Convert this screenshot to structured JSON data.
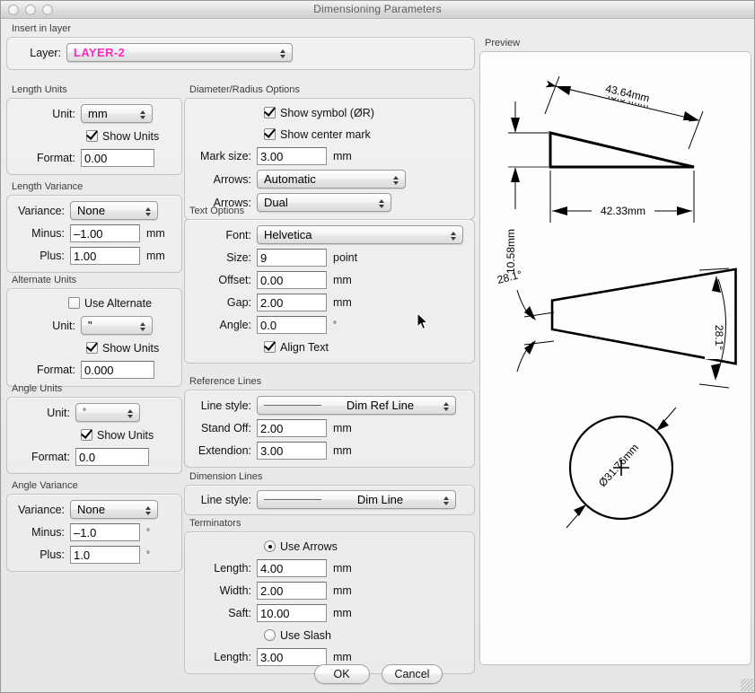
{
  "window": {
    "title": "Dimensioning Parameters",
    "traffic": [
      "close-button",
      "minimize-button",
      "zoom-button"
    ]
  },
  "insert_in_layer": {
    "group_label": "Insert in layer",
    "layer_label": "Layer:",
    "layer_value": "LAYER-2",
    "layer_color": "#ff26c8"
  },
  "length_units": {
    "group_label": "Length Units",
    "unit_label": "Unit:",
    "unit_value": "mm",
    "show_units_label": "Show Units",
    "show_units_checked": true,
    "format_label": "Format:",
    "format_value": "0.00"
  },
  "length_variance": {
    "group_label": "Length Variance",
    "variance_label": "Variance:",
    "variance_value": "None",
    "minus_label": "Minus:",
    "minus_value": "–1.00",
    "minus_unit": "mm",
    "plus_label": "Plus:",
    "plus_value": "1.00",
    "plus_unit": "mm"
  },
  "alternate_units": {
    "group_label": "Alternate Units",
    "use_alternate_label": "Use Alternate",
    "use_alternate_checked": false,
    "unit_label": "Unit:",
    "unit_value": "\"",
    "show_units_label": "Show Units",
    "show_units_checked": true,
    "format_label": "Format:",
    "format_value": "0.000"
  },
  "angle_units": {
    "group_label": "Angle Units",
    "unit_label": "Unit:",
    "unit_value": "°",
    "show_units_label": "Show Units",
    "show_units_checked": true,
    "format_label": "Format:",
    "format_value": "0.0"
  },
  "angle_variance": {
    "group_label": "Angle Variance",
    "variance_label": "Variance:",
    "variance_value": "None",
    "minus_label": "Minus:",
    "minus_value": "–1.0",
    "minus_unit": "°",
    "plus_label": "Plus:",
    "plus_value": "1.0",
    "plus_unit": "°"
  },
  "diameter_radius": {
    "group_label": "Diameter/Radius Options",
    "show_symbol_label": "Show symbol (ØR)",
    "show_symbol_checked": true,
    "show_center_mark_label": "Show center mark",
    "show_center_mark_checked": true,
    "mark_size_label": "Mark size:",
    "mark_size_value": "3.00",
    "mark_size_unit": "mm",
    "arrows1_label": "Arrows:",
    "arrows1_value": "Automatic",
    "arrows2_label": "Arrows:",
    "arrows2_value": "Dual"
  },
  "text_options": {
    "group_label": "Text Options",
    "font_label": "Font:",
    "font_value": "Helvetica",
    "size_label": "Size:",
    "size_value": "9",
    "size_unit": "point",
    "offset_label": "Offset:",
    "offset_value": "0.00",
    "offset_unit": "mm",
    "gap_label": "Gap:",
    "gap_value": "2.00",
    "gap_unit": "mm",
    "angle_label": "Angle:",
    "angle_value": "0.0",
    "angle_unit": "°",
    "align_text_label": "Align Text",
    "align_text_checked": true
  },
  "reference_lines": {
    "group_label": "Reference Lines",
    "line_style_label": "Line style:",
    "line_style_value": "Dim Ref Line",
    "stand_off_label": "Stand Off:",
    "stand_off_value": "2.00",
    "stand_off_unit": "mm",
    "extendion_label": "Extendion:",
    "extendion_value": "3.00",
    "extendion_unit": "mm"
  },
  "dimension_lines": {
    "group_label": "Dimension Lines",
    "line_style_label": "Line style:",
    "line_style_value": "Dim Line"
  },
  "terminators": {
    "group_label": "Terminators",
    "use_arrows_label": "Use Arrows",
    "use_arrows_selected": true,
    "length_label": "Length:",
    "length_value": "4.00",
    "length_unit": "mm",
    "width_label": "Width:",
    "width_value": "2.00",
    "width_unit": "mm",
    "saft_label": "Saft:",
    "saft_value": "10.00",
    "saft_unit": "mm",
    "use_slash_label": "Use Slash",
    "use_slash_selected": false,
    "slash_length_label": "Length:",
    "slash_length_value": "3.00",
    "slash_length_unit": "mm"
  },
  "preview": {
    "group_label": "Preview",
    "dim_angled": "43.64mm",
    "dim_horizontal": "42.33mm",
    "dim_vertical": "10.58mm",
    "angle_left": "28.1°",
    "angle_right": "28.1°",
    "diameter": "Ø31.76mm"
  },
  "footer": {
    "ok_label": "OK",
    "cancel_label": "Cancel"
  }
}
